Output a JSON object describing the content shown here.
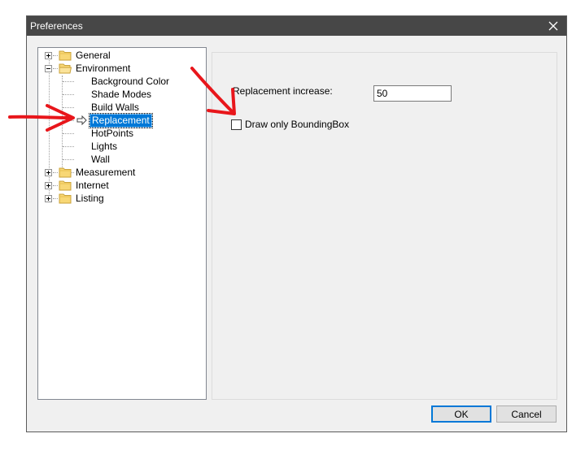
{
  "window": {
    "title": "Preferences",
    "close_glyph": "✕"
  },
  "tree": {
    "items": [
      {
        "label": "General"
      },
      {
        "label": "Environment"
      },
      {
        "label": "Background Color"
      },
      {
        "label": "Shade Modes"
      },
      {
        "label": "Build Walls"
      },
      {
        "label": "Replacement"
      },
      {
        "label": "HotPoints"
      },
      {
        "label": "Lights"
      },
      {
        "label": "Wall"
      },
      {
        "label": "Measurement"
      },
      {
        "label": "Internet"
      },
      {
        "label": "Listing"
      }
    ],
    "selected": "Replacement"
  },
  "panel": {
    "replacement_increase_label": "Replacement increase:",
    "replacement_increase_value": "50",
    "bounding_box_label": "Draw  only BoundingBox",
    "bounding_box_checked": false
  },
  "buttons": {
    "ok": "OK",
    "cancel": "Cancel"
  },
  "colors": {
    "annotation_arrow": "#e8161b",
    "selection": "#0078d7",
    "titlebar": "#474747"
  }
}
